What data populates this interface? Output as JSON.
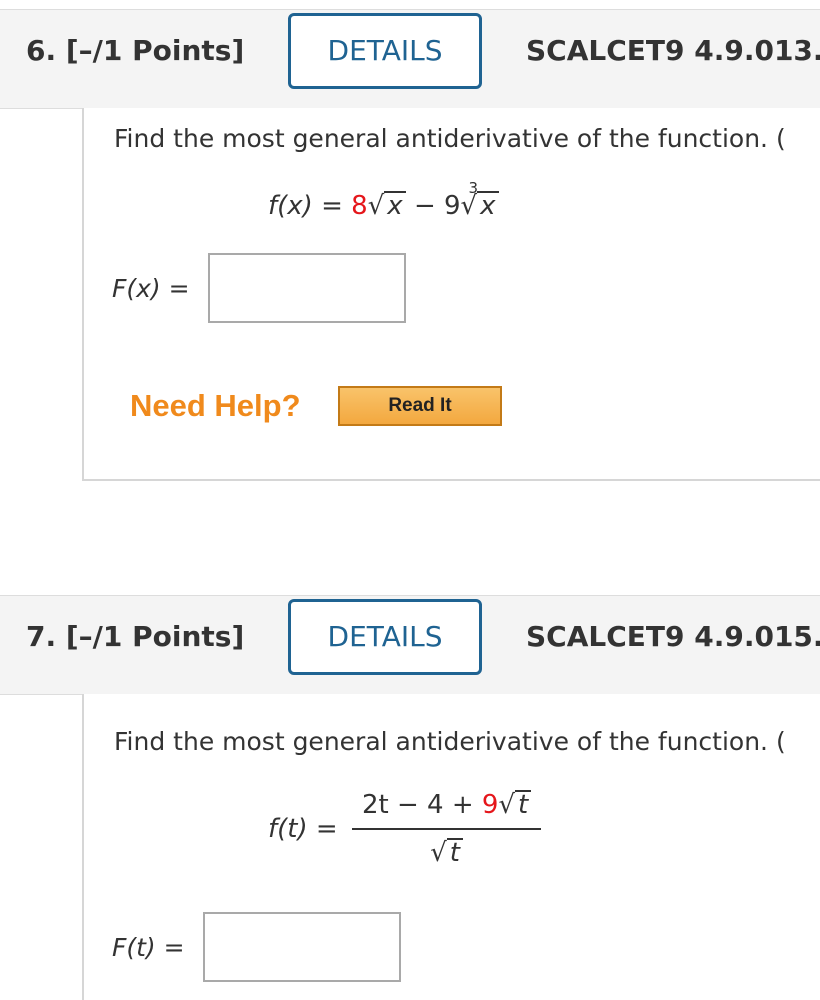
{
  "questions": [
    {
      "number_points": "6. [–/1 Points]",
      "details_label": "DETAILS",
      "code": "SCALCET9 4.9.013.",
      "prompt": "Find the most general antiderivative of the function. (",
      "formula": {
        "lhs": "f(x)",
        "equals": "=",
        "coef1": "8",
        "var": "x",
        "minus": "−",
        "coef2": "9",
        "root_index": "3"
      },
      "answer_label": "F(x) =",
      "answer_value": "",
      "need_help": "Need Help?",
      "read_it": "Read It"
    },
    {
      "number_points": "7. [–/1 Points]",
      "details_label": "DETAILS",
      "code": "SCALCET9 4.9.015.",
      "prompt": "Find the most general antiderivative of the function. (",
      "formula": {
        "lhs": "f(t)",
        "equals": "=",
        "num_start": "2t − 4 + ",
        "num_coef": "9",
        "var": "t"
      },
      "answer_label": "F(t) =",
      "answer_value": ""
    }
  ],
  "colors": {
    "accent": "#1f6392",
    "highlight": "#e5161b",
    "help": "#f08a1c",
    "header_bg": "#f4f4f4"
  }
}
